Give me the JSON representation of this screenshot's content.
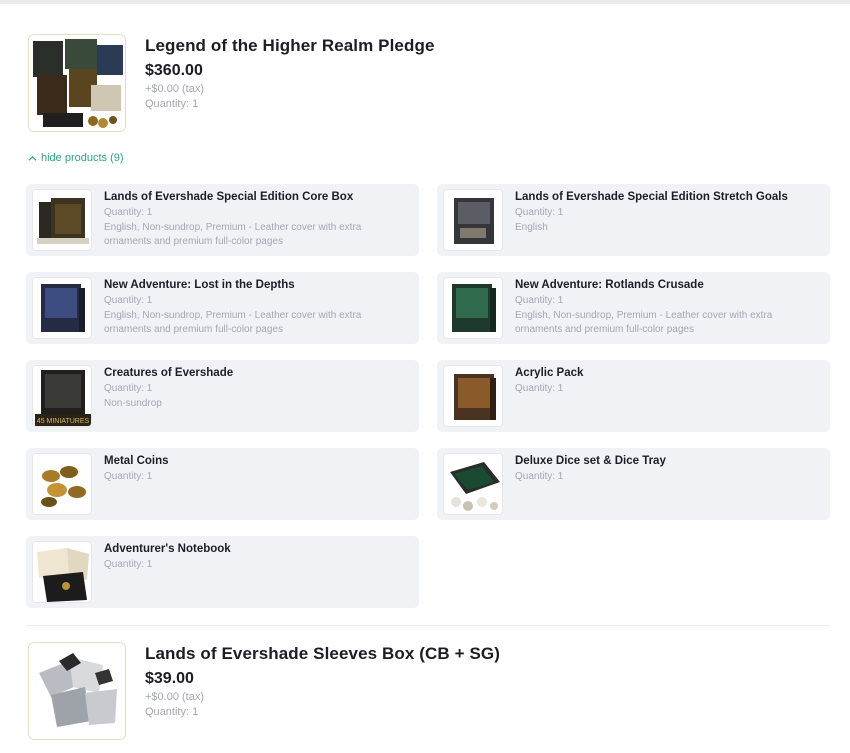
{
  "pledge": {
    "title": "Legend of the Higher Realm Pledge",
    "price": "$360.00",
    "tax": "+$0.00 (tax)",
    "quantity": "Quantity: 1",
    "thumb_icon": "product-bundle-image"
  },
  "toggle": {
    "label": "hide products (9)",
    "icon": "chevron-up-icon",
    "color": "#2fa37a"
  },
  "products": [
    {
      "title": "Lands of Evershade Special Edition Core Box",
      "quantity": "Quantity: 1",
      "desc": "English, Non-sundrop, Premium - Leather cover with extra ornaments and premium full-color pages"
    },
    {
      "title": "Lands of Evershade Special Edition Stretch Goals",
      "quantity": "Quantity: 1",
      "desc": "English"
    },
    {
      "title": "New Adventure: Lost in the Depths",
      "quantity": "Quantity: 1",
      "desc": "English, Non-sundrop, Premium - Leather cover with extra ornaments and premium full-color pages"
    },
    {
      "title": "New Adventure: Rotlands Crusade",
      "quantity": "Quantity: 1",
      "desc": "English, Non-sundrop, Premium - Leather cover with extra ornaments and premium full-color pages"
    },
    {
      "title": "Creatures of Evershade",
      "quantity": "Quantity: 1",
      "desc": "Non-sundrop",
      "badge": "45 MINIATURES"
    },
    {
      "title": "Acrylic Pack",
      "quantity": "Quantity: 1",
      "desc": ""
    },
    {
      "title": "Metal Coins",
      "quantity": "Quantity: 1",
      "desc": ""
    },
    {
      "title": "Deluxe Dice set & Dice Tray",
      "quantity": "Quantity: 1",
      "desc": ""
    },
    {
      "title": "Adventurer's Notebook",
      "quantity": "Quantity: 1",
      "desc": ""
    }
  ],
  "addon": {
    "title": "Lands of Evershade Sleeves Box (CB + SG)",
    "price": "$39.00",
    "tax": "+$0.00 (tax)",
    "quantity": "Quantity: 1"
  }
}
